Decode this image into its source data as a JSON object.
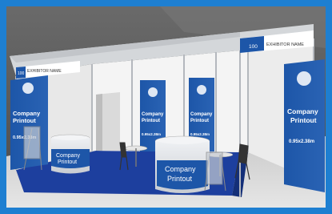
{
  "colors": {
    "border": "#1e7fd1",
    "back_wall": "#f4f4f4",
    "panel_blue": "#1d56a8",
    "panel_blue_dark": "#173f86",
    "carpet": "#1d3f9e",
    "frame": "#b9bdc2",
    "grey_bg": "#5d5d5d"
  },
  "fascia_right": {
    "number": "100",
    "name": "EXHIBITOR NAME"
  },
  "fascia_left": {
    "number": "100",
    "name": "EXHIBITOR NAME"
  },
  "posters": [
    {
      "title_line1": "Company",
      "title_line2": "Printout",
      "size": "0.95x2.38m"
    },
    {
      "title_line1": "Company",
      "title_line2": "Printout",
      "size": "0.95x2.38m"
    },
    {
      "title_line1": "Company",
      "title_line2": "Printout",
      "size": "0.95x2.38m"
    },
    {
      "title_line1": "Company",
      "title_line2": "Printout",
      "size": "0.95x2.38m"
    }
  ],
  "counter_left": {
    "line1": "Company",
    "line2": "Printout"
  },
  "counter_center": {
    "line1": "Company",
    "line2": "Printout"
  },
  "icons": [
    "logo-icon",
    "chair-icon",
    "table-icon",
    "brochure-stand-icon"
  ]
}
